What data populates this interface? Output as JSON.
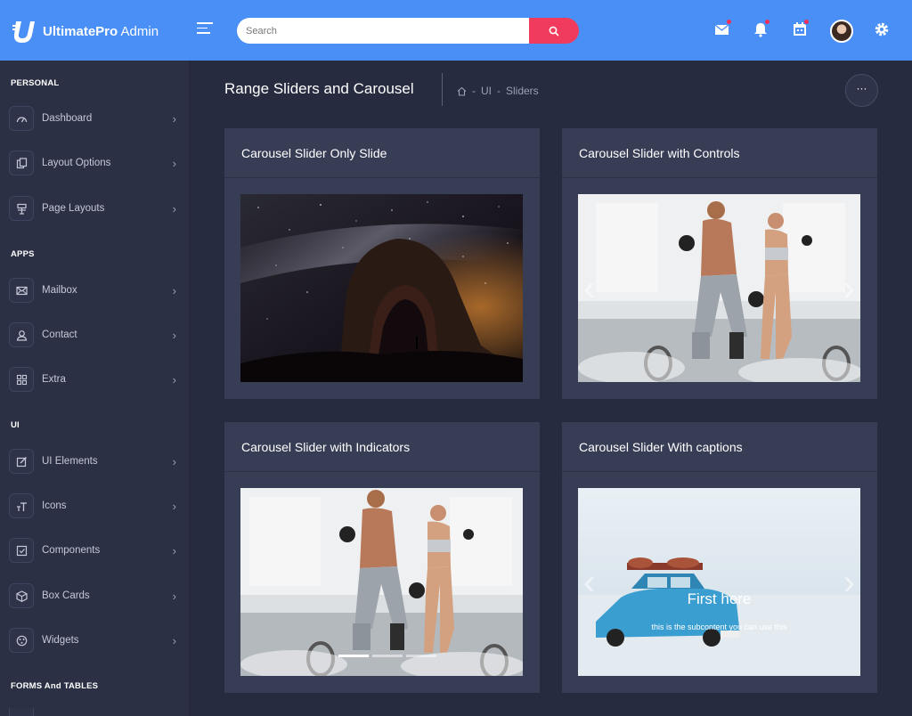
{
  "header": {
    "logo_bold": "UltimatePro",
    "logo_light": " Admin",
    "search_placeholder": "Search",
    "accent": "#4a8ff6",
    "search_button_color": "#f03b5c"
  },
  "sidebar": {
    "sections": [
      {
        "title": "PERSONAL",
        "items": [
          "Dashboard",
          "Layout Options",
          "Page Layouts"
        ]
      },
      {
        "title": "APPS",
        "items": [
          "Mailbox",
          "Contact",
          "Extra"
        ]
      },
      {
        "title": "UI",
        "items": [
          "UI Elements",
          "Icons",
          "Components",
          "Box Cards",
          "Widgets"
        ]
      },
      {
        "title": "FORMS And TABLES",
        "items": []
      }
    ]
  },
  "page": {
    "title": "Range Sliders and Carousel",
    "breadcrumb": [
      "UI",
      "Sliders"
    ],
    "more_label": "···"
  },
  "cards": [
    {
      "title": "Carousel Slider Only Slide"
    },
    {
      "title": "Carousel Slider with Controls"
    },
    {
      "title": "Carousel Slider with Indicators"
    },
    {
      "title": "Carousel Slider With captions",
      "caption_title": "First here",
      "caption_text": "this is the subcontent you can use this"
    }
  ],
  "icons": [
    "menu-icon",
    "search-icon",
    "mail-icon",
    "bell-icon",
    "calendar-icon",
    "avatar",
    "gear-icon",
    "home-icon"
  ]
}
